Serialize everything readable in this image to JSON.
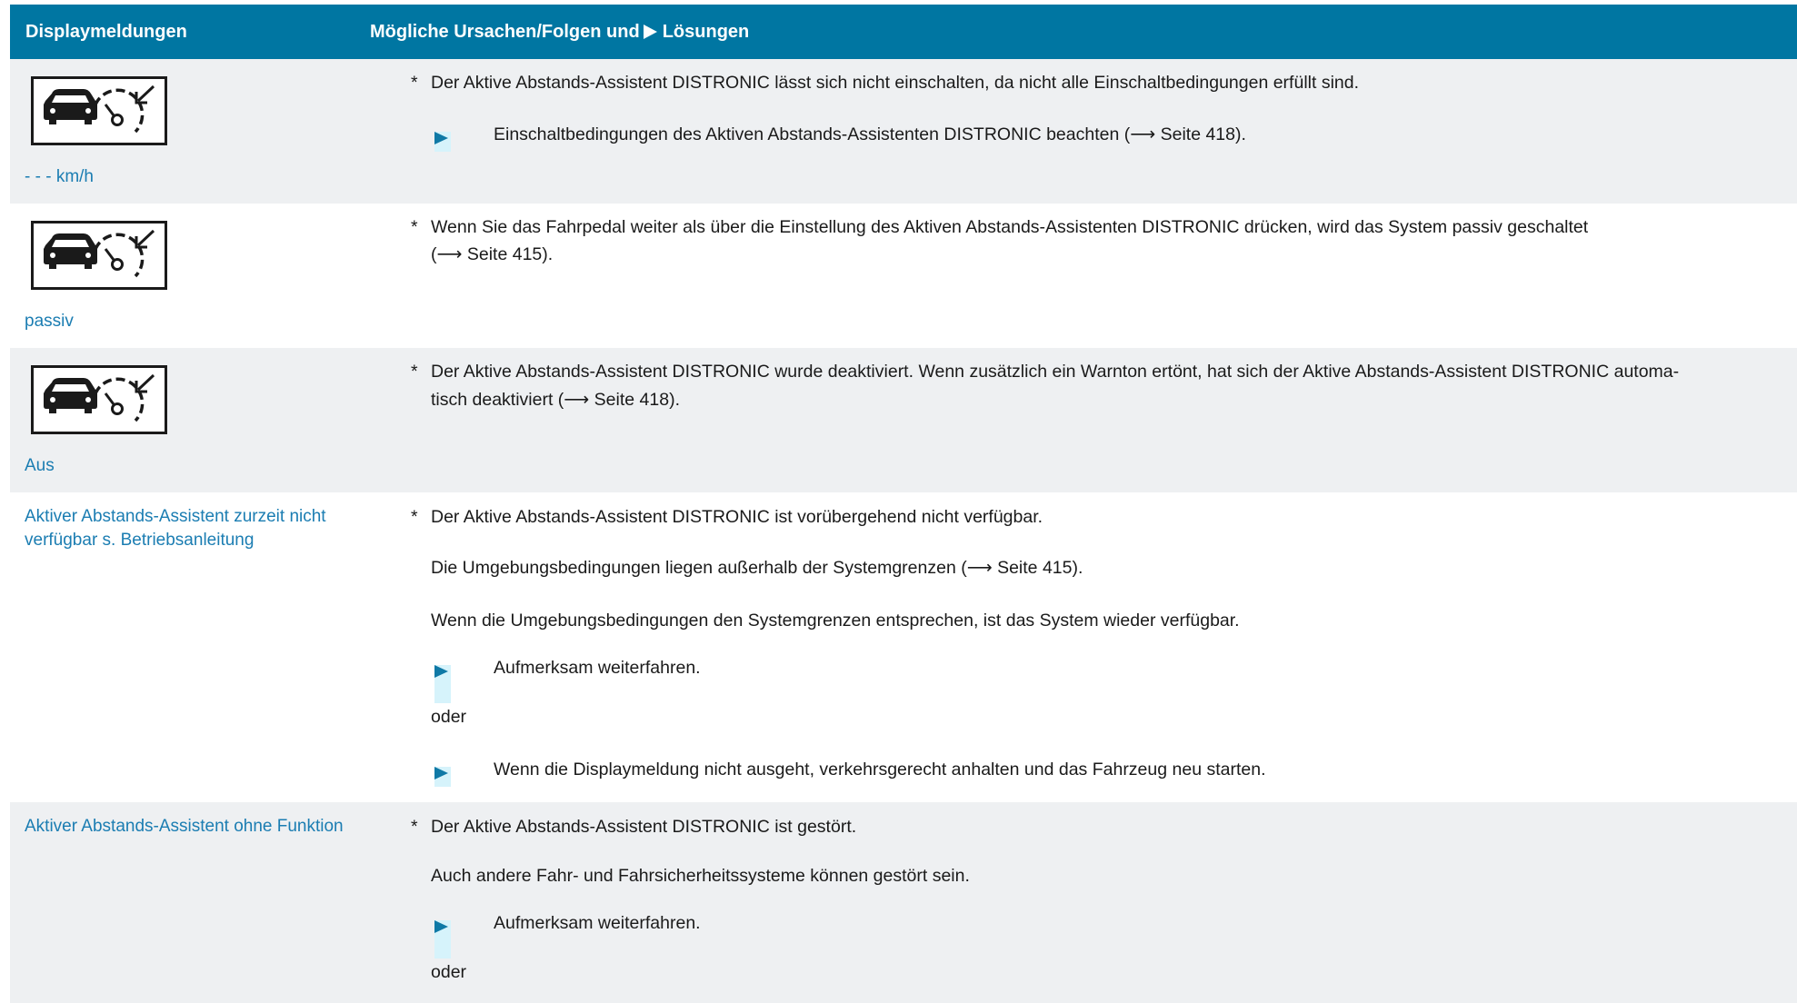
{
  "header": {
    "col1": "Displaymeldungen",
    "col2_pre": "Mögliche Ursachen/Folgen und",
    "col2_post": "Lösungen"
  },
  "rows": [
    {
      "label": "- - - km/h",
      "cause": "Der Aktive Abstands-Assistent DISTRONIC lässt sich nicht einschalten, da nicht alle Einschaltbedingungen erfüllt sind.",
      "step1": "Einschaltbedingungen des Aktiven Abstands-Assistenten DISTRONIC beachten (⟶ Seite 418)."
    },
    {
      "label": "passiv",
      "cause_line1": "Wenn Sie das Fahrpedal weiter als über die Einstellung des Aktiven Abstands-Assistenten DISTRONIC drücken, wird das System passiv geschaltet",
      "cause_line2": "(⟶ Seite 415)."
    },
    {
      "label": "Aus",
      "cause_line1": "Der Aktive Abstands-Assistent DISTRONIC wurde deaktiviert. Wenn zusätzlich ein Warnton ertönt, hat sich der Aktive Abstands-Assistent DISTRONIC automa-",
      "cause_line2": "tisch deaktiviert (⟶ Seite 418)."
    },
    {
      "label_line1": "Aktiver Abstands-Assistent zurzeit nicht",
      "label_line2": "verfügbar s. Betriebsanleitung",
      "cause": "Der Aktive Abstands-Assistent DISTRONIC ist vorübergehend nicht verfügbar.",
      "para1": "Die Umgebungsbedingungen liegen außerhalb der Systemgrenzen (⟶ Seite 415).",
      "para2": "Wenn die Umgebungsbedingungen den Systemgrenzen entsprechen, ist das System wieder verfügbar.",
      "step1": "Aufmerksam weiterfahren.",
      "oder": "oder",
      "step2": "Wenn die Displaymeldung nicht ausgeht, verkehrsgerecht anhalten und das Fahrzeug neu starten."
    },
    {
      "label": "Aktiver Abstands-Assistent ohne Funktion",
      "cause": "Der Aktive Abstands-Assistent DISTRONIC ist gestört.",
      "para1": "Auch andere Fahr- und Fahrsicherheitssysteme können gestört sein.",
      "step1": "Aufmerksam weiterfahren.",
      "oder": "oder"
    }
  ],
  "bullet_symbol": "*",
  "colors": {
    "header_bg": "#0076a2",
    "row_gray": "#eef0f2",
    "label_blue": "#1b7db2",
    "arrow_blue": "#0f79a6"
  },
  "icon_name": "distronic-speedometer-icon"
}
